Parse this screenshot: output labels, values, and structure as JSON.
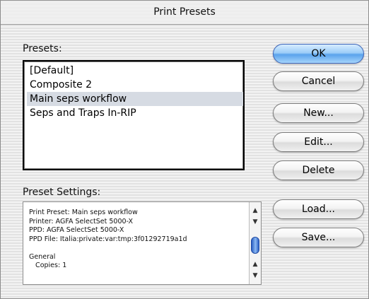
{
  "window": {
    "title": "Print Presets"
  },
  "presets": {
    "label": "Presets:",
    "items": [
      "[Default]",
      "Composite 2",
      "Main seps workflow",
      "Seps and Traps In-RIP"
    ],
    "selected": "Main seps workflow"
  },
  "buttons": {
    "ok": "OK",
    "cancel": "Cancel",
    "new": "New...",
    "edit": "Edit...",
    "delete": "Delete",
    "load": "Load...",
    "save": "Save..."
  },
  "settings": {
    "label": "Preset Settings:",
    "lines": [
      "Print Preset: Main seps workflow",
      "Printer: AGFA SelectSet 5000-X",
      "PPD: AGFA SelectSet 5000-X",
      "PPD File: Italia:private:var:tmp:3f01292719a1d",
      "",
      "General",
      "   Copies: 1"
    ]
  },
  "colors": {
    "default_button": "#5aa3ec",
    "selection": "#d6dbe3"
  },
  "icons": {
    "scroll_up": "▲",
    "scroll_down": "▼"
  }
}
